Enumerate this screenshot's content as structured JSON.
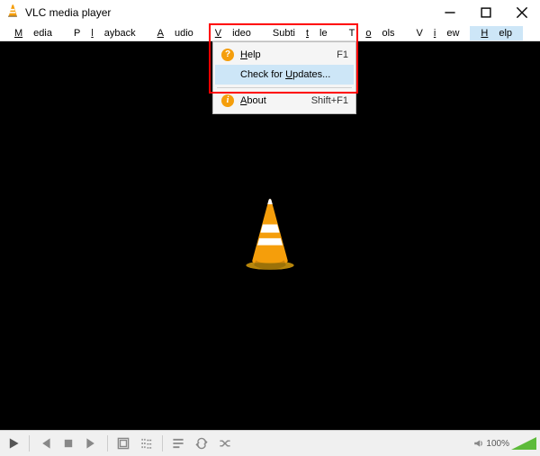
{
  "titlebar": {
    "title": "VLC media player"
  },
  "menus": {
    "media": "Media",
    "playback": "Playback",
    "audio": "Audio",
    "video": "Video",
    "subtitle": "Subtitle",
    "tools": "Tools",
    "view": "View",
    "help": "Help"
  },
  "help_menu": {
    "help_label": "Help",
    "help_shortcut": "F1",
    "update_label": "Check for Updates...",
    "about_label": "About",
    "about_shortcut": "Shift+F1"
  },
  "volume": {
    "percent": "100%"
  }
}
